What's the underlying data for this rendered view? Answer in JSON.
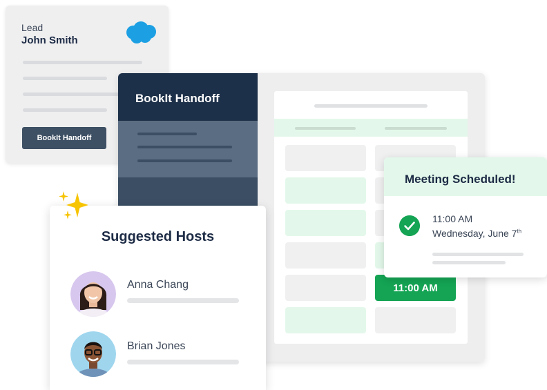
{
  "lead_card": {
    "label": "Lead",
    "name": "John Smith",
    "button_label": "BookIt Handoff",
    "logo_icon": "cloud-icon"
  },
  "app_panel": {
    "sidebar_title": "BookIt Handoff",
    "selected_slot": "11:00 AM"
  },
  "meeting_card": {
    "title": "Meeting Scheduled!",
    "time": "11:00 AM",
    "date": "Wednesday, June 7",
    "date_suffix": "th",
    "status_icon": "check-circle-icon"
  },
  "hosts_card": {
    "title": "Suggested Hosts",
    "hosts": [
      {
        "name": "Anna Chang"
      },
      {
        "name": "Brian Jones"
      }
    ]
  },
  "colors": {
    "navy": "#1d3049",
    "green": "#14a454",
    "light_green": "#e3f8ea",
    "cloud_blue": "#1ca0e3"
  }
}
